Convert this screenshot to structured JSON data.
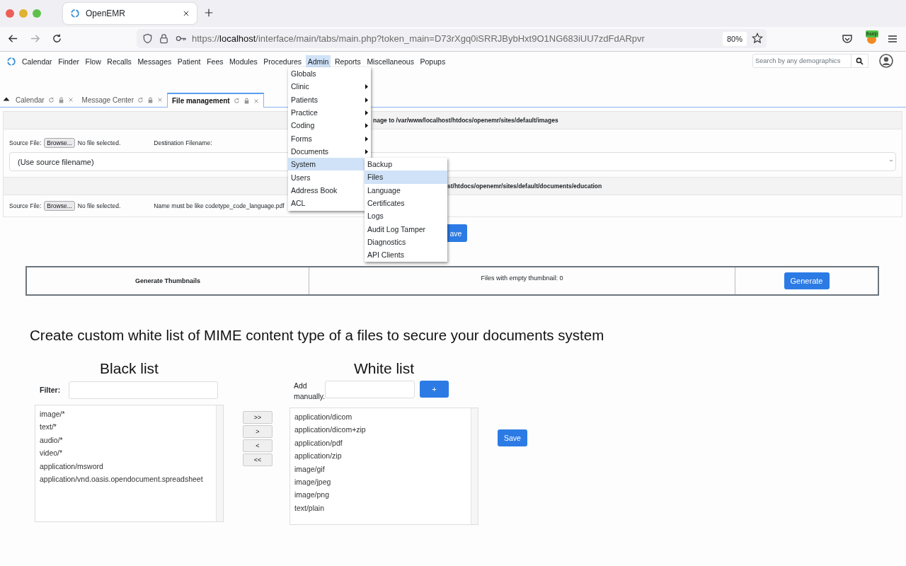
{
  "browser": {
    "tab_title": "OpenEMR",
    "url": {
      "scheme": "https://",
      "host": "localhost",
      "path": "/interface/main/tabs/main.php?token_main=D73rXgq0iSRRJBybHxt9O1NG683iUU7zdFdARpvr"
    },
    "zoom": "80%",
    "extension_badge": "burp"
  },
  "nav": {
    "items": [
      {
        "label": "Calendar",
        "selected": false
      },
      {
        "label": "Finder",
        "selected": false
      },
      {
        "label": "Flow",
        "selected": false
      },
      {
        "label": "Recalls",
        "selected": false
      },
      {
        "label": "Messages",
        "selected": false
      },
      {
        "label": "Patient",
        "selected": false
      },
      {
        "label": "Fees",
        "selected": false
      },
      {
        "label": "Modules",
        "selected": false
      },
      {
        "label": "Procedures",
        "selected": false
      },
      {
        "label": "Admin",
        "selected": true
      },
      {
        "label": "Reports",
        "selected": false
      },
      {
        "label": "Miscellaneous",
        "selected": false
      },
      {
        "label": "Popups",
        "selected": false
      }
    ],
    "search": {
      "placeholder": "Search by any demographics"
    }
  },
  "tabs": [
    {
      "label": "Calendar",
      "selected": false
    },
    {
      "label": "Message Center",
      "selected": false
    },
    {
      "label": "File management",
      "selected": true
    }
  ],
  "admin_menu": [
    {
      "label": "Globals",
      "submenu": false,
      "selected": false
    },
    {
      "label": "Clinic",
      "submenu": true,
      "selected": false
    },
    {
      "label": "Patients",
      "submenu": true,
      "selected": false
    },
    {
      "label": "Practice",
      "submenu": true,
      "selected": false
    },
    {
      "label": "Coding",
      "submenu": true,
      "selected": false
    },
    {
      "label": "Forms",
      "submenu": true,
      "selected": false
    },
    {
      "label": "Documents",
      "submenu": true,
      "selected": false
    },
    {
      "label": "System",
      "submenu": false,
      "selected": true
    },
    {
      "label": "Users",
      "submenu": false,
      "selected": false
    },
    {
      "label": "Address Book",
      "submenu": false,
      "selected": false
    },
    {
      "label": "ACL",
      "submenu": false,
      "selected": false
    }
  ],
  "system_menu": [
    {
      "label": "Backup",
      "selected": false
    },
    {
      "label": "Files",
      "selected": true
    },
    {
      "label": "Language",
      "selected": false
    },
    {
      "label": "Certificates",
      "selected": false
    },
    {
      "label": "Logs",
      "selected": false
    },
    {
      "label": "Audit Log Tamper",
      "selected": false
    },
    {
      "label": "Diagnostics",
      "selected": false
    },
    {
      "label": "API Clients",
      "selected": false
    }
  ],
  "image_upload": {
    "header": "nage to /var/www/localhost/htdocs/openemr/sites/default/images",
    "source_label": "Source File:",
    "browse": "Browse...",
    "no_file": "No file selected.",
    "destination_label": "Destination Filename:",
    "destination_value": "(Use source filename)"
  },
  "education_upload": {
    "header": "st/htdocs/openemr/sites/default/documents/education",
    "source_label": "Source File:",
    "browse": "Browse...",
    "no_file": "No file selected.",
    "hint": "Name must be like codetype_code_language.pdf"
  },
  "save_button": "ave",
  "thumbnails": {
    "title": "Generate Thumbnails",
    "status": "Files with empty thumbnail: 0",
    "button": "Generate"
  },
  "mime_heading": "Create custom white list of MIME content type of a files to secure your documents system",
  "black_list": {
    "title": "Black list",
    "filter_label": "Filter:",
    "items": [
      "image/*",
      "text/*",
      "audio/*",
      "video/*",
      "application/msword",
      "application/vnd.oasis.opendocument.spreadsheet"
    ]
  },
  "move_buttons": [
    ">>",
    ">",
    "<",
    "<<"
  ],
  "white_list": {
    "title": "White list",
    "add_label": "Add manually.",
    "add_button": "+",
    "items": [
      "application/dicom",
      "application/dicom+zip",
      "application/pdf",
      "application/zip",
      "image/gif",
      "image/jpeg",
      "image/png",
      "text/plain"
    ],
    "save": "Save"
  }
}
